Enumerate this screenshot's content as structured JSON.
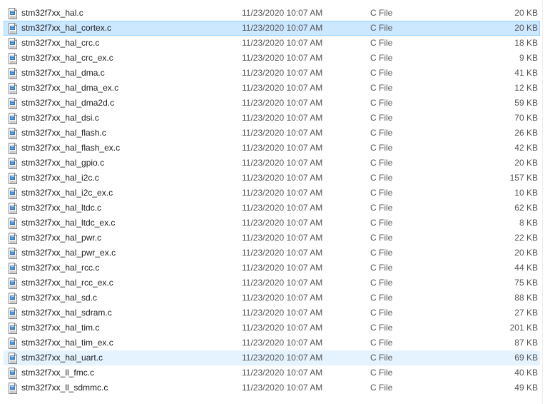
{
  "files": [
    {
      "name": "stm32f7xx_hal.c",
      "date": "11/23/2020 10:07 AM",
      "type": "C File",
      "size": "20 KB",
      "state": "normal"
    },
    {
      "name": "stm32f7xx_hal_cortex.c",
      "date": "11/23/2020 10:07 AM",
      "type": "C File",
      "size": "20 KB",
      "state": "selected"
    },
    {
      "name": "stm32f7xx_hal_crc.c",
      "date": "11/23/2020 10:07 AM",
      "type": "C File",
      "size": "18 KB",
      "state": "normal"
    },
    {
      "name": "stm32f7xx_hal_crc_ex.c",
      "date": "11/23/2020 10:07 AM",
      "type": "C File",
      "size": "9 KB",
      "state": "normal"
    },
    {
      "name": "stm32f7xx_hal_dma.c",
      "date": "11/23/2020 10:07 AM",
      "type": "C File",
      "size": "41 KB",
      "state": "normal"
    },
    {
      "name": "stm32f7xx_hal_dma_ex.c",
      "date": "11/23/2020 10:07 AM",
      "type": "C File",
      "size": "12 KB",
      "state": "normal"
    },
    {
      "name": "stm32f7xx_hal_dma2d.c",
      "date": "11/23/2020 10:07 AM",
      "type": "C File",
      "size": "59 KB",
      "state": "normal"
    },
    {
      "name": "stm32f7xx_hal_dsi.c",
      "date": "11/23/2020 10:07 AM",
      "type": "C File",
      "size": "70 KB",
      "state": "normal"
    },
    {
      "name": "stm32f7xx_hal_flash.c",
      "date": "11/23/2020 10:07 AM",
      "type": "C File",
      "size": "26 KB",
      "state": "normal"
    },
    {
      "name": "stm32f7xx_hal_flash_ex.c",
      "date": "11/23/2020 10:07 AM",
      "type": "C File",
      "size": "42 KB",
      "state": "normal"
    },
    {
      "name": "stm32f7xx_hal_gpio.c",
      "date": "11/23/2020 10:07 AM",
      "type": "C File",
      "size": "20 KB",
      "state": "normal"
    },
    {
      "name": "stm32f7xx_hal_i2c.c",
      "date": "11/23/2020 10:07 AM",
      "type": "C File",
      "size": "157 KB",
      "state": "normal"
    },
    {
      "name": "stm32f7xx_hal_i2c_ex.c",
      "date": "11/23/2020 10:07 AM",
      "type": "C File",
      "size": "10 KB",
      "state": "normal"
    },
    {
      "name": "stm32f7xx_hal_ltdc.c",
      "date": "11/23/2020 10:07 AM",
      "type": "C File",
      "size": "62 KB",
      "state": "normal"
    },
    {
      "name": "stm32f7xx_hal_ltdc_ex.c",
      "date": "11/23/2020 10:07 AM",
      "type": "C File",
      "size": "8 KB",
      "state": "normal"
    },
    {
      "name": "stm32f7xx_hal_pwr.c",
      "date": "11/23/2020 10:07 AM",
      "type": "C File",
      "size": "22 KB",
      "state": "normal"
    },
    {
      "name": "stm32f7xx_hal_pwr_ex.c",
      "date": "11/23/2020 10:07 AM",
      "type": "C File",
      "size": "20 KB",
      "state": "normal"
    },
    {
      "name": "stm32f7xx_hal_rcc.c",
      "date": "11/23/2020 10:07 AM",
      "type": "C File",
      "size": "44 KB",
      "state": "normal"
    },
    {
      "name": "stm32f7xx_hal_rcc_ex.c",
      "date": "11/23/2020 10:07 AM",
      "type": "C File",
      "size": "75 KB",
      "state": "normal"
    },
    {
      "name": "stm32f7xx_hal_sd.c",
      "date": "11/23/2020 10:07 AM",
      "type": "C File",
      "size": "88 KB",
      "state": "normal"
    },
    {
      "name": "stm32f7xx_hal_sdram.c",
      "date": "11/23/2020 10:07 AM",
      "type": "C File",
      "size": "27 KB",
      "state": "normal"
    },
    {
      "name": "stm32f7xx_hal_tim.c",
      "date": "11/23/2020 10:07 AM",
      "type": "C File",
      "size": "201 KB",
      "state": "normal"
    },
    {
      "name": "stm32f7xx_hal_tim_ex.c",
      "date": "11/23/2020 10:07 AM",
      "type": "C File",
      "size": "87 KB",
      "state": "normal"
    },
    {
      "name": "stm32f7xx_hal_uart.c",
      "date": "11/23/2020 10:07 AM",
      "type": "C File",
      "size": "69 KB",
      "state": "hover"
    },
    {
      "name": "stm32f7xx_ll_fmc.c",
      "date": "11/23/2020 10:07 AM",
      "type": "C File",
      "size": "40 KB",
      "state": "normal"
    },
    {
      "name": "stm32f7xx_ll_sdmmc.c",
      "date": "11/23/2020 10:07 AM",
      "type": "C File",
      "size": "49 KB",
      "state": "normal"
    }
  ],
  "icon": "c-source-file-icon",
  "colors": {
    "selected_bg": "#cce8ff",
    "selected_border": "#99d1ff",
    "hover_bg": "#e5f3ff",
    "detail_text": "#555555"
  }
}
